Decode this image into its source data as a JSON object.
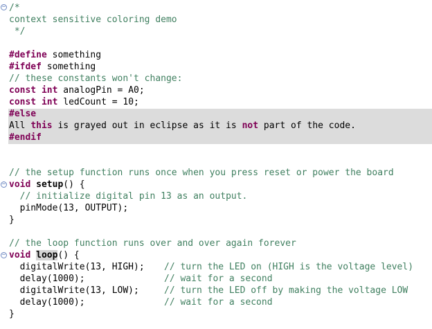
{
  "editor": {
    "lines": {
      "l1": "/*",
      "l2": "context sensitive coloring demo",
      "l3": " */",
      "l5_kw": "#define",
      "l5_rest": " something",
      "l6_kw": "#ifdef",
      "l6_rest": " something",
      "l7": "// these constants won't change:",
      "l8_kw1": "const",
      "l8_kw2": "int",
      "l8_rest": " analogPin = A0;",
      "l9_kw1": "const",
      "l9_kw2": "int",
      "l9_rest": " ledCount = 10;",
      "l10_kw": "#else",
      "l11_a": "All ",
      "l11_kw1": "this",
      "l11_b": " is grayed out in eclipse as it is ",
      "l11_kw2": "not",
      "l11_c": " part of the code.",
      "l12_kw": "#endif",
      "l15": "// the setup function runs once when you press reset or power the board",
      "l16_kw": "void",
      "l16_fn": "setup",
      "l16_rest": "() {",
      "l17": "  // initialize digital pin 13 as an output.",
      "l18": "  pinMode(13, OUTPUT);",
      "l19": "}",
      "l21": "// the loop function runs over and over again forever",
      "l22_kw": "void",
      "l22_fn": "loop",
      "l22_rest": "() {",
      "l23_code": "  digitalWrite(13, HIGH);",
      "l23_comment": "// turn the LED on (HIGH is the voltage level)",
      "l24_code": "  delay(1000);",
      "l24_comment": "// wait for a second",
      "l25_code": "  digitalWrite(13, LOW);",
      "l25_comment": "// turn the LED off by making the voltage LOW",
      "l26_code": "  delay(1000);",
      "l26_comment": "// wait for a second",
      "l27": "}"
    },
    "fold_icon": "minus",
    "colors": {
      "keyword": "#7f0055",
      "comment": "#3f7f5f",
      "inactive_background": "#dcdcdc"
    }
  }
}
